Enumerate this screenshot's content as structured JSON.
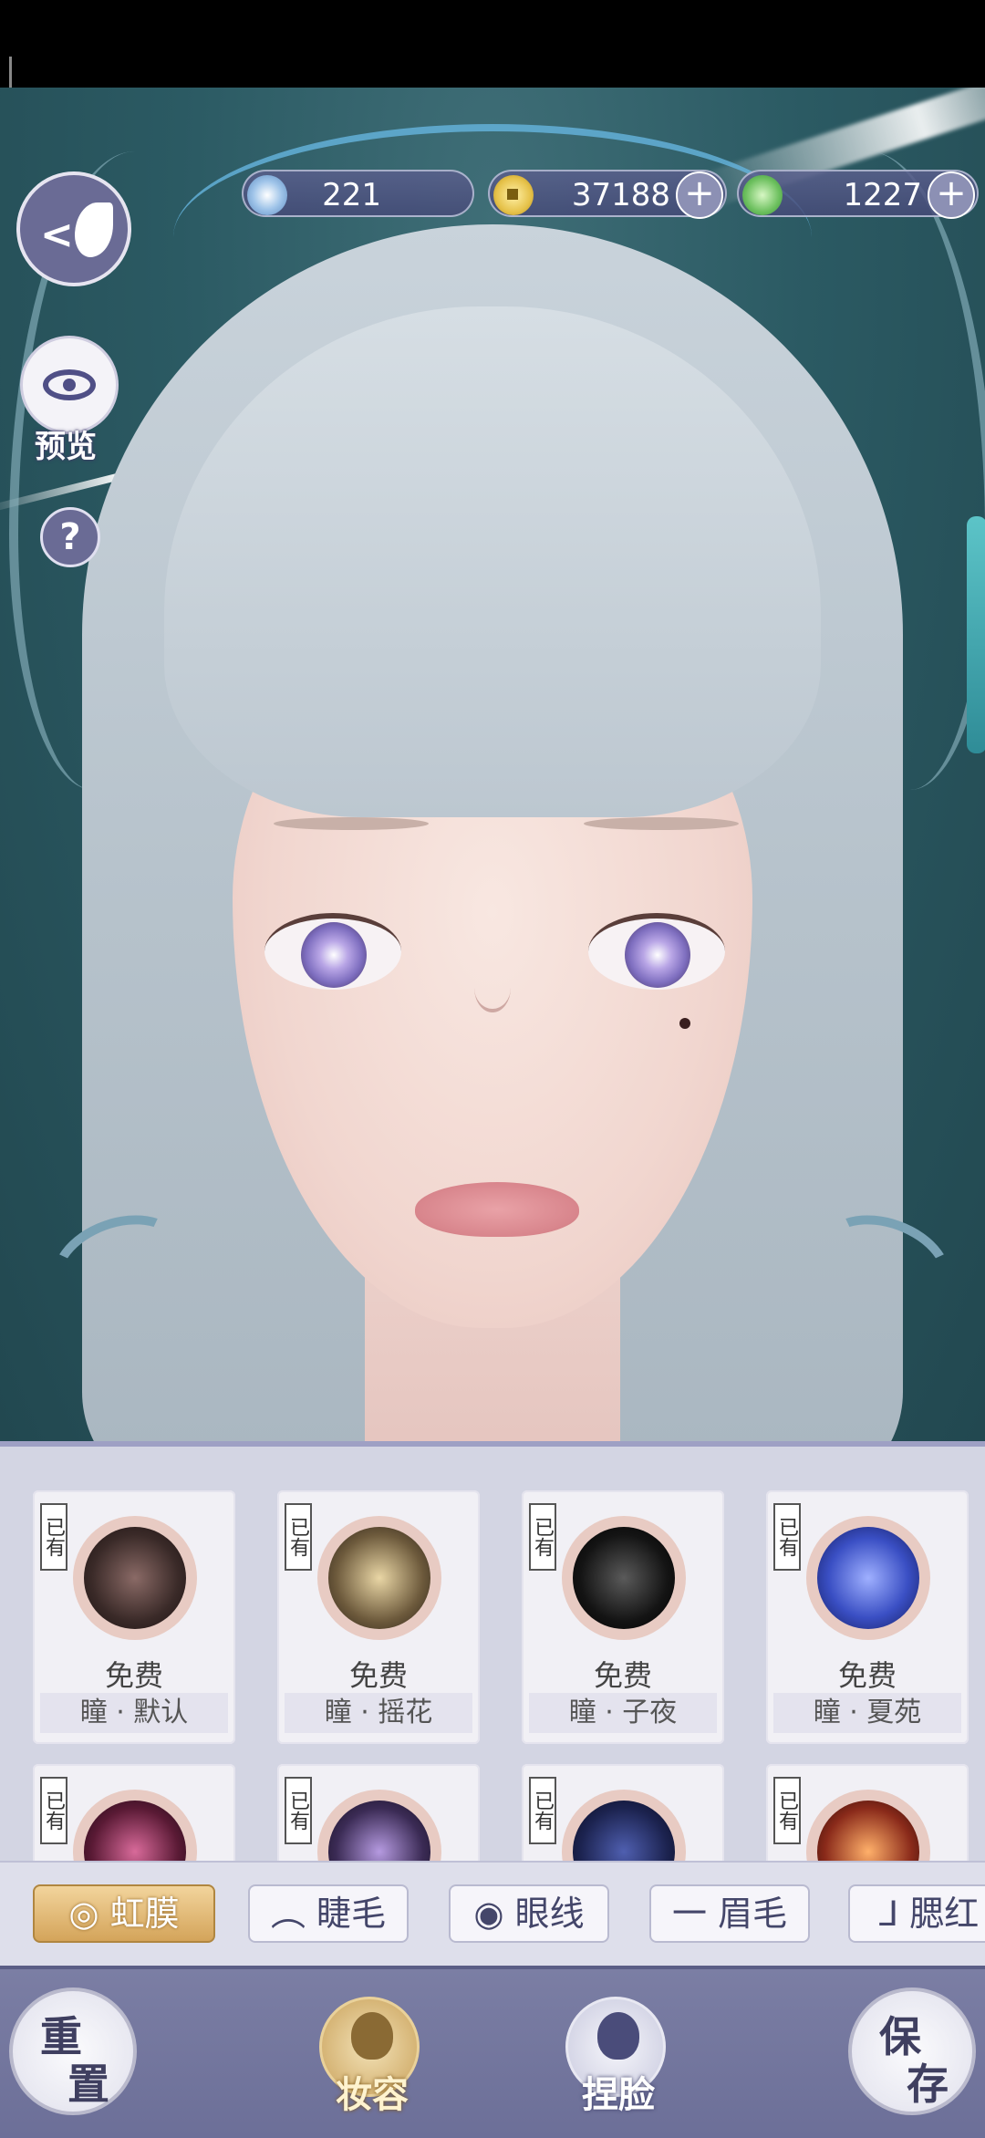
{
  "currency": {
    "jade": {
      "value": "221",
      "icon": "jade-coin-icon"
    },
    "gold": {
      "value": "37188",
      "icon": "copper-coin-icon"
    },
    "green": {
      "value": "1227",
      "icon": "green-token-icon"
    }
  },
  "side": {
    "preview_label": "预览",
    "help_glyph": "?"
  },
  "items": [
    {
      "owned": "已有",
      "price": "免费",
      "name": "瞳 · 默认",
      "color": "#3a2a28"
    },
    {
      "owned": "已有",
      "price": "免费",
      "name": "瞳 · 摇花",
      "color": "#6d5a3c"
    },
    {
      "owned": "已有",
      "price": "免费",
      "name": "瞳 · 子夜",
      "color": "#141414"
    },
    {
      "owned": "已有",
      "price": "免费",
      "name": "瞳 · 夏苑",
      "color": "#3a4fc4"
    },
    {
      "owned": "已有",
      "price": "",
      "name": "",
      "color": "#5a1a35"
    },
    {
      "owned": "已有",
      "price": "",
      "name": "",
      "color": "#3b2b55"
    },
    {
      "owned": "已有",
      "price": "",
      "name": "",
      "color": "#1c2350"
    },
    {
      "owned": "已有",
      "price": "",
      "name": "",
      "color": "#8a2a1a"
    }
  ],
  "tabs": [
    {
      "label": "虹膜",
      "icon": "iris-icon",
      "active": true
    },
    {
      "label": "睫毛",
      "icon": "eyelash-icon",
      "active": false
    },
    {
      "label": "眼线",
      "icon": "eyeliner-icon",
      "active": false
    },
    {
      "label": "眉毛",
      "icon": "eyebrow-icon",
      "active": false
    },
    {
      "label": "腮红",
      "icon": "blush-icon",
      "active": false
    }
  ],
  "bottom": {
    "reset": [
      "重",
      "置"
    ],
    "makeup_label": "妆容",
    "face_label": "捏脸",
    "save": [
      "保",
      "存"
    ]
  }
}
